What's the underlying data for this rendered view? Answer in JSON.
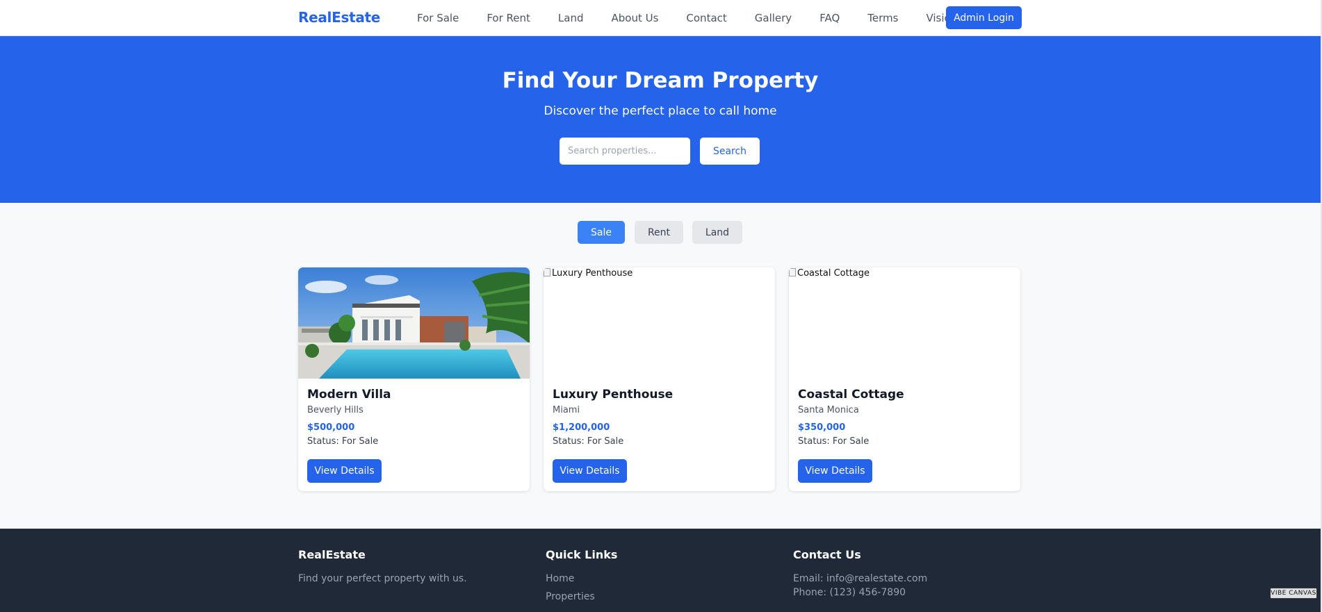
{
  "nav": {
    "brand": "RealEstate",
    "links": [
      "For Sale",
      "For Rent",
      "Land",
      "About Us",
      "Contact",
      "Gallery",
      "FAQ",
      "Terms",
      "Vision"
    ],
    "admin_label": "Admin Login"
  },
  "hero": {
    "title": "Find Your Dream Property",
    "subtitle": "Discover the perfect place to call home",
    "search_placeholder": "Search properties...",
    "search_label": "Search"
  },
  "filters": [
    "Sale",
    "Rent",
    "Land"
  ],
  "active_filter": "Sale",
  "cards": [
    {
      "title": "Modern Villa",
      "location": "Beverly Hills",
      "price": "$500,000",
      "status": "Status: For Sale",
      "button": "View Details",
      "image_alt": "Modern Villa",
      "image_loaded": true
    },
    {
      "title": "Luxury Penthouse",
      "location": "Miami",
      "price": "$1,200,000",
      "status": "Status: For Sale",
      "button": "View Details",
      "image_alt": "Luxury Penthouse",
      "image_loaded": false
    },
    {
      "title": "Coastal Cottage",
      "location": "Santa Monica",
      "price": "$350,000",
      "status": "Status: For Sale",
      "button": "View Details",
      "image_alt": "Coastal Cottage",
      "image_loaded": false
    }
  ],
  "footer": {
    "brand": "RealEstate",
    "tagline": "Find your perfect property with us.",
    "quick_links_title": "Quick Links",
    "quick_links": [
      "Home",
      "Properties"
    ],
    "contact_title": "Contact Us",
    "email": "Email: info@realestate.com",
    "phone": "Phone: (123) 456-7890"
  },
  "watermark": "VIBE CANVAS",
  "colors": {
    "accent": "#2563eb",
    "footer_bg": "#1f2937"
  }
}
